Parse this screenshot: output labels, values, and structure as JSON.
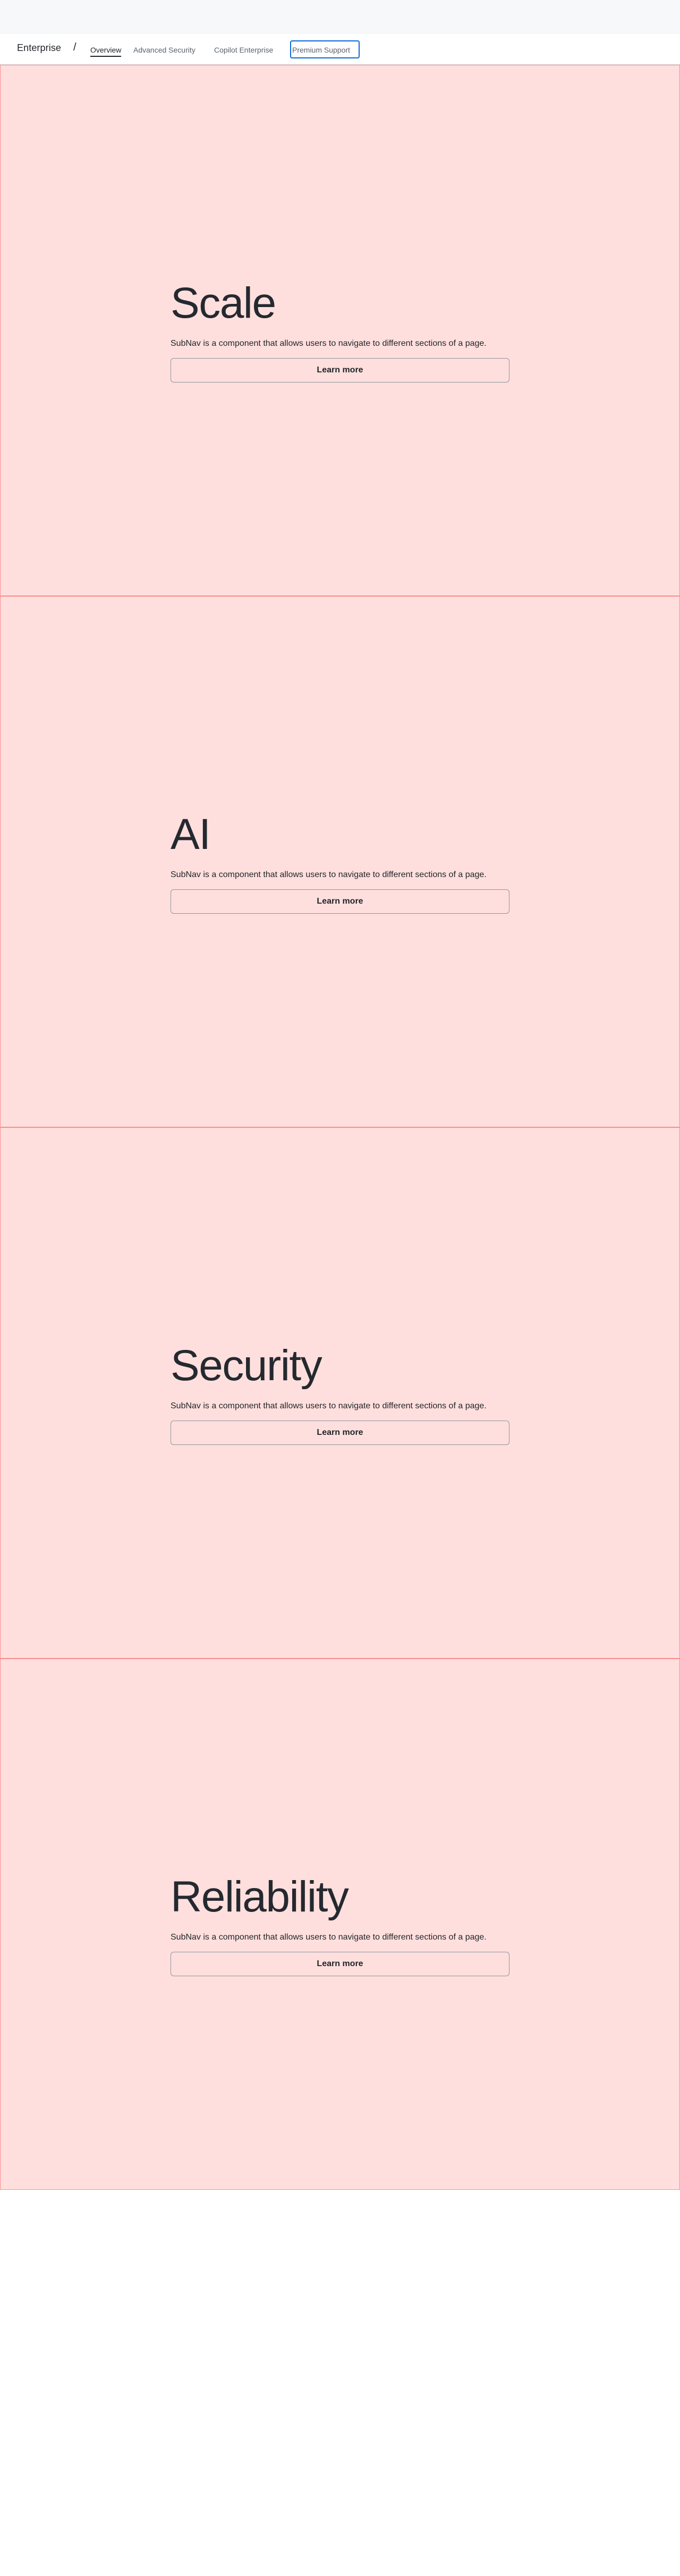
{
  "subnav": {
    "heading": "Enterprise",
    "separator": "/",
    "links": [
      {
        "label": "Overview",
        "active": true
      },
      {
        "label": "Advanced Security",
        "active": false
      },
      {
        "label": "Copilot Enterprise",
        "active": false
      },
      {
        "label": "Premium Support",
        "active": false
      }
    ]
  },
  "sections": [
    {
      "title": "Scale",
      "description": "SubNav is a component that allows users to navigate to different sections of a page.",
      "cta_label": "Learn more"
    },
    {
      "title": "AI",
      "description": "SubNav is a component that allows users to navigate to different sections of a page.",
      "cta_label": "Learn more"
    },
    {
      "title": "Security",
      "description": "SubNav is a component that allows users to navigate to different sections of a page.",
      "cta_label": "Learn more"
    },
    {
      "title": "Reliability",
      "description": "SubNav is a component that allows users to navigate to different sections of a page.",
      "cta_label": "Learn more"
    }
  ],
  "colors": {
    "section_bg": "#ffdfdd",
    "section_border": "#fa8c8c",
    "focus_ring": "#0969da",
    "text": "#1f2328"
  }
}
